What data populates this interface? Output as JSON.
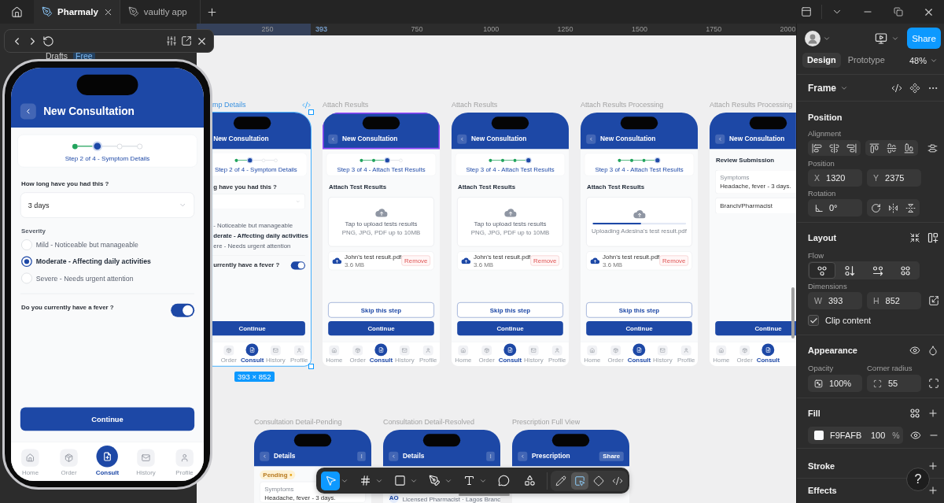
{
  "title_bar": {
    "tabs": [
      {
        "label": "Pharmaly",
        "selected": true,
        "closable": true
      },
      {
        "label": "vaultly app",
        "selected": false,
        "closable": false
      }
    ]
  },
  "sidebar": {
    "drafts": "Drafts",
    "plan": "Free"
  },
  "prototype": {
    "screen": {
      "kind": "symptom",
      "title": "New Consultation",
      "steps": [
        {
          "done": true,
          "current": false
        },
        {
          "done": false,
          "current": true
        },
        {
          "done": false,
          "current": false
        },
        {
          "done": false,
          "current": false
        }
      ],
      "step_text": "Step 2 of 4 - Symptom Details",
      "question": "How long have you had this ?",
      "duration": "3 days",
      "severity_label": "Severity",
      "options": [
        {
          "label": "Mild - Noticeable but manageable",
          "selected": false
        },
        {
          "label": "Moderate - Affecting daily activities",
          "selected": true
        },
        {
          "label": "Severe - Needs urgent attention",
          "selected": false
        }
      ],
      "fever_question": "Do you currently have a fever ?",
      "fever": true,
      "continue": "Continue",
      "nav": [
        {
          "label": "Home",
          "selected": false
        },
        {
          "label": "Order",
          "selected": false
        },
        {
          "label": "Consult",
          "selected": true
        },
        {
          "label": "History",
          "selected": false
        },
        {
          "label": "Profile",
          "selected": false
        }
      ]
    }
  },
  "ruler": {
    "ticks": [
      "250",
      "750",
      "1000",
      "1250",
      "1500",
      "1750",
      "2000"
    ],
    "selection_end": "393"
  },
  "canvas": {
    "frames": [
      {
        "label": "mp Details",
        "selected": true,
        "hovered": false,
        "screen": {
          "kind": "symptom",
          "title": "New Consultation",
          "steps": [
            {
              "done": true,
              "current": false
            },
            {
              "done": false,
              "current": true
            },
            {
              "done": false,
              "current": false
            },
            {
              "done": false,
              "current": false
            }
          ],
          "step_text": "Step 2 of 4 - Symptom Details",
          "question": "g have you had this ?",
          "options": [
            {
              "label": "- Noticeable but manageable",
              "selected": false
            },
            {
              "label": "derate - Affecting daily activities",
              "selected": true
            },
            {
              "label": "ere - Needs urgent attention",
              "selected": false
            }
          ],
          "fever_question": "urrently have a fever ?",
          "fever": true,
          "continue": "Continue",
          "nav": [
            {
              "label": "Order",
              "selected": false
            },
            {
              "label": "Consult",
              "selected": true
            },
            {
              "label": "History",
              "selected": false
            },
            {
              "label": "Profile",
              "selected": false
            }
          ]
        }
      },
      {
        "label": "Attach Results",
        "selected": false,
        "hovered": true,
        "screen": {
          "kind": "attach",
          "title": "New Consultation",
          "steps": [
            {
              "done": true,
              "current": false
            },
            {
              "done": true,
              "current": false
            },
            {
              "done": false,
              "current": true
            },
            {
              "done": false,
              "current": false
            }
          ],
          "step_text": "Step 3 of 4 - Attach Test Results",
          "section_title": "Attach Test Results",
          "upload": {
            "kind": "prompt",
            "prompt": "Tap to upload tests results",
            "hint": "PNG, JPG, PDF up to 10MB"
          },
          "file": {
            "name": "John's test result.pdf",
            "size": "3.6 MB",
            "action": "Remove"
          },
          "skip": "Skip this step",
          "continue": "Continue",
          "nav": [
            {
              "label": "Home",
              "selected": false
            },
            {
              "label": "Order",
              "selected": false
            },
            {
              "label": "Consult",
              "selected": true
            },
            {
              "label": "History",
              "selected": false
            },
            {
              "label": "Profile",
              "selected": false
            }
          ]
        }
      },
      {
        "label": "Attach Results",
        "selected": false,
        "hovered": false,
        "screen": {
          "kind": "attach",
          "title": "New Consultation",
          "steps": [
            {
              "done": true,
              "current": false
            },
            {
              "done": true,
              "current": false
            },
            {
              "done": true,
              "current": false
            },
            {
              "done": false,
              "current": true
            }
          ],
          "step_text": "Step 3 of 4 - Attach Test Results",
          "section_title": "Attach Test Results",
          "upload": {
            "kind": "prompt",
            "prompt": "Tap to upload tests results",
            "hint": "PNG, JPG, PDF up to 10MB"
          },
          "file": {
            "name": "John's test result.pdf",
            "size": "3.6 MB",
            "action": "Remove"
          },
          "skip": "Skip this step",
          "continue": "Continue",
          "nav": [
            {
              "label": "Home",
              "selected": false
            },
            {
              "label": "Order",
              "selected": false
            },
            {
              "label": "Consult",
              "selected": true
            },
            {
              "label": "History",
              "selected": false
            },
            {
              "label": "Profile",
              "selected": false
            }
          ]
        }
      },
      {
        "label": "Attach Results Processing",
        "selected": false,
        "hovered": false,
        "screen": {
          "kind": "attach",
          "title": "New Consultation",
          "steps": [
            {
              "done": true,
              "current": false
            },
            {
              "done": true,
              "current": false
            },
            {
              "done": true,
              "current": false
            },
            {
              "done": false,
              "current": true
            }
          ],
          "step_text": "Step 3 of 4 - Attach Test Results",
          "section_title": "Attach Test Results",
          "upload": {
            "kind": "progress",
            "label": "Uploading Adesina's test result.pdf",
            "level": 0.52
          },
          "file": {
            "name": "John's test result.pdf",
            "size": "3.6 MB",
            "action": "Remove"
          },
          "skip": "Skip this step",
          "continue": "Continue",
          "nav": [
            {
              "label": "Home",
              "selected": false
            },
            {
              "label": "Order",
              "selected": false
            },
            {
              "label": "Consult",
              "selected": true
            },
            {
              "label": "History",
              "selected": false
            },
            {
              "label": "Profile",
              "selected": false
            }
          ]
        }
      },
      {
        "label": "Attach Results Processing",
        "selected": false,
        "hovered": false,
        "screen": {
          "kind": "review",
          "title": "New Consultation",
          "section_title": "Review Submission",
          "summary": [
            {
              "label": "Symptoms",
              "value": "Headache, fever - 3 days."
            },
            {
              "value": "Branch/Pharmacist"
            }
          ],
          "continue": "Continue",
          "nav": [
            {
              "label": "Home",
              "selected": false
            },
            {
              "label": "Order",
              "selected": false
            },
            {
              "label": "Consult",
              "selected": true
            }
          ]
        }
      }
    ],
    "selection_size": "393 × 852",
    "detail_frames": [
      {
        "label": "Consultation Detail-Pending",
        "screen": {
          "kind": "detail",
          "title": "Details",
          "action": {
            "kind": "menu"
          },
          "status": "Pending",
          "summary": [
            {
              "label": "Symptoms",
              "value": "Headache, fever - 3 days."
            }
          ]
        }
      },
      {
        "label": "Consultation Detail-Resolved",
        "screen": {
          "kind": "detail",
          "title": "Details",
          "action": {
            "kind": "menu"
          },
          "pharmacist": {
            "initials": "AO",
            "note": "Licensed Pharmacist · Lagos Branc"
          }
        }
      },
      {
        "label": "Prescription Full View",
        "screen": {
          "kind": "detail",
          "title": "Prescription",
          "action": {
            "kind": "share",
            "label": "Share"
          }
        }
      }
    ]
  },
  "toolbar": {
    "tools": [
      {
        "selected": true,
        "menu": true
      },
      {
        "selected": false,
        "menu": true
      },
      {
        "selected": false,
        "menu": true
      },
      {
        "selected": false,
        "menu": true
      },
      {
        "selected": false,
        "menu": true
      },
      {
        "selected": false,
        "menu": false
      },
      {
        "selected": false,
        "menu": false
      }
    ],
    "modes": [
      {
        "selected": false
      },
      {
        "selected": true
      },
      {
        "selected": false
      },
      {
        "selected": false
      }
    ]
  },
  "design_panel": {
    "share": "Share",
    "tabs": [
      {
        "label": "Design",
        "selected": true
      },
      {
        "label": "Prototype",
        "selected": false
      }
    ],
    "zoom": "48%",
    "layer": "Frame",
    "position": {
      "title": "Position",
      "alignment": "Alignment",
      "position": "Position",
      "x": {
        "axis": "X",
        "value": "1320"
      },
      "y": {
        "axis": "Y",
        "value": "2375"
      },
      "rotation": "Rotation",
      "angle": "0°"
    },
    "layout": {
      "title": "Layout",
      "flow": "Flow",
      "flow_options": [
        {
          "selected": true
        },
        {
          "selected": false
        },
        {
          "selected": false
        },
        {
          "selected": false
        }
      ],
      "dimensions": "Dimensions",
      "w": {
        "axis": "W",
        "value": "393"
      },
      "h": {
        "axis": "H",
        "value": "852"
      },
      "clip": {
        "label": "Clip content",
        "checked": true
      }
    },
    "appearance": {
      "title": "Appearance",
      "opacity_label": "Opacity",
      "opacity": "100%",
      "radius_label": "Corner radius",
      "radius": "55"
    },
    "fill": {
      "title": "Fill",
      "hex": "F9FAFB",
      "opacity": "100",
      "unit": "%"
    },
    "stroke": {
      "title": "Stroke"
    },
    "effects": {
      "title": "Effects"
    },
    "help": "?"
  }
}
